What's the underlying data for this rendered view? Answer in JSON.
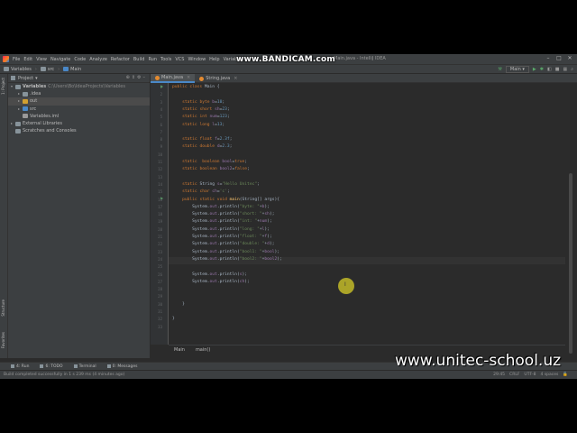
{
  "window": {
    "menu": [
      "File",
      "Edit",
      "View",
      "Navigate",
      "Code",
      "Analyze",
      "Refactor",
      "Build",
      "Run",
      "Tools",
      "VCS",
      "Window",
      "Help",
      "Variables"
    ],
    "title_suffix": "Main.java - IntelliJ IDEA"
  },
  "watermark": "www.BANDICAM.com",
  "site_overlay": "www.unitec-school.uz",
  "navbar": {
    "crumbs": [
      "Variables",
      "src",
      "Main"
    ],
    "run_config": "Main"
  },
  "project_panel": {
    "title": "Project",
    "tree": [
      {
        "label": "Variables",
        "path": "C:\\Users\\Bo\\IdeaProjects\\Variables",
        "indent": 0,
        "expanded": true,
        "color": "#87939a",
        "bold": true
      },
      {
        "label": ".idea",
        "path": "",
        "indent": 1,
        "expanded": false,
        "color": "#87939a"
      },
      {
        "label": "out",
        "path": "",
        "indent": 1,
        "expanded": false,
        "color": "#d1a031",
        "selected": true
      },
      {
        "label": "src",
        "path": "",
        "indent": 1,
        "expanded": false,
        "color": "#4a88c7"
      },
      {
        "label": "Variables.iml",
        "path": "",
        "indent": 1,
        "expanded": null,
        "color": "#999999"
      },
      {
        "label": "External Libraries",
        "path": "",
        "indent": 0,
        "expanded": false,
        "color": "#87939a"
      },
      {
        "label": "Scratches and Consoles",
        "path": "",
        "indent": 0,
        "expanded": null,
        "color": "#87939a"
      }
    ]
  },
  "side_tabs": {
    "left": [
      "1: Project",
      "Structure",
      "Favorites"
    ]
  },
  "editor": {
    "tabs": [
      {
        "label": "Main.java",
        "active": true
      },
      {
        "label": "String.java",
        "active": false
      }
    ],
    "lines": [
      {
        "n": 1,
        "html": "<span class='kw'>public class</span> Main {"
      },
      {
        "n": 2,
        "html": ""
      },
      {
        "n": 3,
        "html": "    <span class='kw'>static byte</span> <span class='fld'>b</span>=<span class='num'>10</span>;"
      },
      {
        "n": 4,
        "html": "    <span class='kw'>static short</span> <span class='fld'>sh</span>=<span class='num'>23</span>;"
      },
      {
        "n": 5,
        "html": "    <span class='kw'>static int</span> <span class='fld'>num</span>=<span class='num'>123</span>;"
      },
      {
        "n": 6,
        "html": "    <span class='kw'>static long</span> <span class='fld'>l</span>=<span class='num'>13</span>;"
      },
      {
        "n": 7,
        "html": ""
      },
      {
        "n": 8,
        "html": "    <span class='kw'>static float</span> <span class='fld'>f</span>=<span class='num'>2.3f</span>;"
      },
      {
        "n": 9,
        "html": "    <span class='kw'>static double</span> <span class='fld'>d</span>=<span class='num'>2.3</span>;"
      },
      {
        "n": 10,
        "html": ""
      },
      {
        "n": 11,
        "html": "    <span class='kw'>static  boolean</span> <span class='fld'>bool</span>=<span class='kw'>true</span>;"
      },
      {
        "n": 12,
        "html": "    <span class='kw'>static boolean</span> <span class='fld'>bool2</span>=<span class='kw'>false</span>;"
      },
      {
        "n": 13,
        "html": ""
      },
      {
        "n": 14,
        "html": "    <span class='kw'>static</span> String <span class='fld'>s</span>=<span class='str'>\"Hello Unitec\"</span>;"
      },
      {
        "n": 15,
        "html": "    <span class='kw'>static char</span> <span class='fld'>ch</span>=<span class='str'>'c'</span>;"
      },
      {
        "n": 16,
        "html": "    <span class='kw'>public static void</span> <span class='fn'>main</span>(String[] args){"
      },
      {
        "n": 17,
        "html": "        System.<span class='fld'>out</span>.println(<span class='str'>\"byte: \"</span>+<span class='fld'>b</span>);"
      },
      {
        "n": 18,
        "html": "        System.<span class='fld'>out</span>.println(<span class='str'>\"short: \"</span>+<span class='fld'>sh</span>);"
      },
      {
        "n": 19,
        "html": "        System.<span class='fld'>out</span>.println(<span class='str'>\"int: \"</span>+<span class='fld'>num</span>);"
      },
      {
        "n": 20,
        "html": "        System.<span class='fld'>out</span>.println(<span class='str'>\"long: \"</span>+<span class='fld'>l</span>);"
      },
      {
        "n": 21,
        "html": "        System.<span class='fld'>out</span>.println(<span class='str'>\"float: \"</span>+<span class='fld'>f</span>);"
      },
      {
        "n": 22,
        "html": "        System.<span class='fld'>out</span>.println(<span class='str'>\"double: \"</span>+<span class='fld'>d</span>);"
      },
      {
        "n": 23,
        "html": "        System.<span class='fld'>out</span>.println(<span class='str'>\"bool1: \"</span>+<span class='fld'>bool</span>);"
      },
      {
        "n": 24,
        "html": "        System.<span class='fld'>out</span>.println(<span class='str'>\"bool2: \"</span>+<span class='fld'>bool2</span>);",
        "current": true
      },
      {
        "n": 25,
        "html": ""
      },
      {
        "n": 26,
        "html": "        System.<span class='fld'>out</span>.println(<span class='fld'>s</span>);"
      },
      {
        "n": 27,
        "html": "        System.<span class='fld'>out</span>.println(<span class='fld'>ch</span>);"
      },
      {
        "n": 28,
        "html": ""
      },
      {
        "n": 29,
        "html": ""
      },
      {
        "n": 30,
        "html": "    }"
      },
      {
        "n": 31,
        "html": ""
      },
      {
        "n": 32,
        "html": "}"
      },
      {
        "n": 33,
        "html": ""
      }
    ],
    "breadcrumb": [
      "Main",
      "main()"
    ]
  },
  "bottom_tools": [
    "4: Run",
    "6: TODO",
    "Terminal",
    "0: Messages"
  ],
  "status": {
    "message": "Build completed successfully in 1 s 239 ms (4 minutes ago)",
    "position": "29:45",
    "line_sep": "CRLF",
    "encoding": "UTF-8",
    "indent": "4 spaces"
  }
}
